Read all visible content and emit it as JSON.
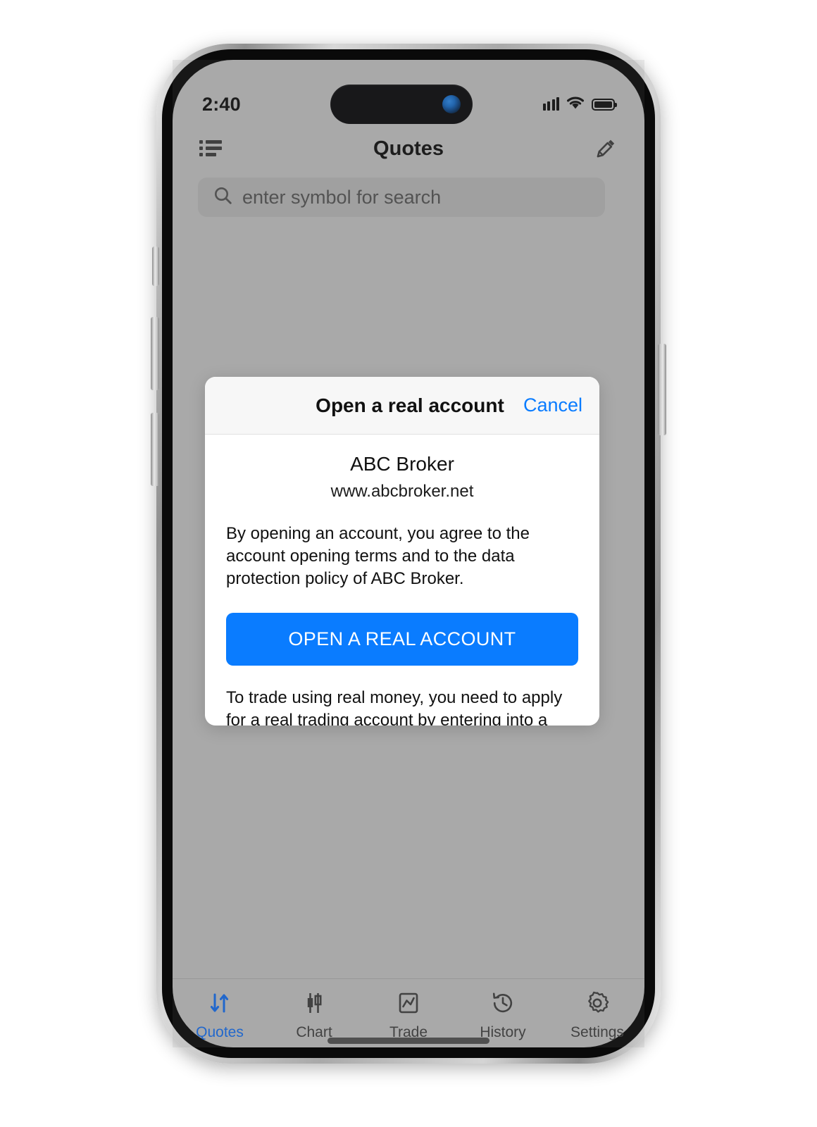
{
  "status_bar": {
    "time": "2:40",
    "cellular_icon": "cellular-bars-icon",
    "wifi_icon": "wifi-icon",
    "battery_icon": "battery-full-icon"
  },
  "nav": {
    "title": "Quotes",
    "left_icon": "list-icon",
    "right_icon": "pencil-edit-icon"
  },
  "search": {
    "placeholder": "enter symbol for search",
    "icon": "search-icon"
  },
  "modal": {
    "title": "Open a real account",
    "cancel_label": "Cancel",
    "broker_name": "ABC Broker",
    "broker_url": "www.abcbroker.net",
    "terms_text": "By opening an account, you agree to the account opening terms and to the data protection policy of ABC Broker.",
    "cta_label": "OPEN A REAL ACCOUNT",
    "note_text": "To trade using real money, you need to apply for a real trading account by entering into a separate agreement with a financial services company.",
    "accent_color": "#0a7cff"
  },
  "tabs": [
    {
      "label": "Quotes",
      "icon": "arrows-up-down-icon",
      "active": true
    },
    {
      "label": "Chart",
      "icon": "candlestick-icon",
      "active": false
    },
    {
      "label": "Trade",
      "icon": "chart-box-icon",
      "active": false
    },
    {
      "label": "History",
      "icon": "clock-history-icon",
      "active": false
    },
    {
      "label": "Settings",
      "icon": "gear-icon",
      "active": false
    }
  ],
  "colors": {
    "accent_blue": "#0a7cff",
    "tab_active": "#1565d8",
    "screen_bg": "#b0b0b0"
  }
}
